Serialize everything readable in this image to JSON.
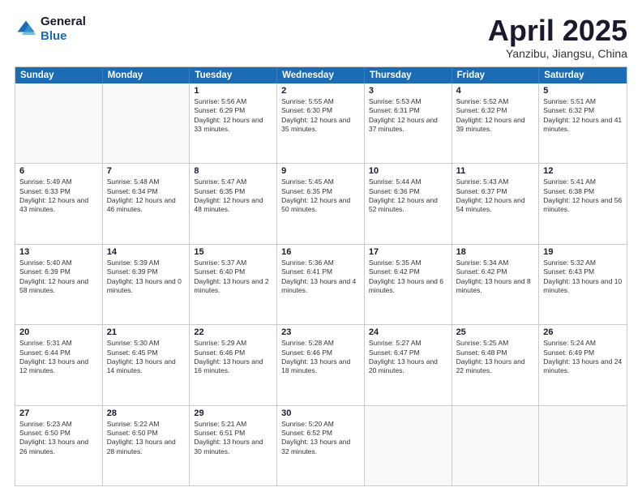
{
  "logo": {
    "line1": "General",
    "line2": "Blue"
  },
  "header": {
    "month": "April 2025",
    "location": "Yanzibu, Jiangsu, China"
  },
  "days_of_week": [
    "Sunday",
    "Monday",
    "Tuesday",
    "Wednesday",
    "Thursday",
    "Friday",
    "Saturday"
  ],
  "weeks": [
    [
      {
        "day": "",
        "empty": true
      },
      {
        "day": "",
        "empty": true
      },
      {
        "day": "1",
        "sunrise": "5:56 AM",
        "sunset": "6:29 PM",
        "daylight": "12 hours and 33 minutes."
      },
      {
        "day": "2",
        "sunrise": "5:55 AM",
        "sunset": "6:30 PM",
        "daylight": "12 hours and 35 minutes."
      },
      {
        "day": "3",
        "sunrise": "5:53 AM",
        "sunset": "6:31 PM",
        "daylight": "12 hours and 37 minutes."
      },
      {
        "day": "4",
        "sunrise": "5:52 AM",
        "sunset": "6:32 PM",
        "daylight": "12 hours and 39 minutes."
      },
      {
        "day": "5",
        "sunrise": "5:51 AM",
        "sunset": "6:32 PM",
        "daylight": "12 hours and 41 minutes."
      }
    ],
    [
      {
        "day": "6",
        "sunrise": "5:49 AM",
        "sunset": "6:33 PM",
        "daylight": "12 hours and 43 minutes."
      },
      {
        "day": "7",
        "sunrise": "5:48 AM",
        "sunset": "6:34 PM",
        "daylight": "12 hours and 46 minutes."
      },
      {
        "day": "8",
        "sunrise": "5:47 AM",
        "sunset": "6:35 PM",
        "daylight": "12 hours and 48 minutes."
      },
      {
        "day": "9",
        "sunrise": "5:45 AM",
        "sunset": "6:35 PM",
        "daylight": "12 hours and 50 minutes."
      },
      {
        "day": "10",
        "sunrise": "5:44 AM",
        "sunset": "6:36 PM",
        "daylight": "12 hours and 52 minutes."
      },
      {
        "day": "11",
        "sunrise": "5:43 AM",
        "sunset": "6:37 PM",
        "daylight": "12 hours and 54 minutes."
      },
      {
        "day": "12",
        "sunrise": "5:41 AM",
        "sunset": "6:38 PM",
        "daylight": "12 hours and 56 minutes."
      }
    ],
    [
      {
        "day": "13",
        "sunrise": "5:40 AM",
        "sunset": "6:39 PM",
        "daylight": "12 hours and 58 minutes."
      },
      {
        "day": "14",
        "sunrise": "5:39 AM",
        "sunset": "6:39 PM",
        "daylight": "13 hours and 0 minutes."
      },
      {
        "day": "15",
        "sunrise": "5:37 AM",
        "sunset": "6:40 PM",
        "daylight": "13 hours and 2 minutes."
      },
      {
        "day": "16",
        "sunrise": "5:36 AM",
        "sunset": "6:41 PM",
        "daylight": "13 hours and 4 minutes."
      },
      {
        "day": "17",
        "sunrise": "5:35 AM",
        "sunset": "6:42 PM",
        "daylight": "13 hours and 6 minutes."
      },
      {
        "day": "18",
        "sunrise": "5:34 AM",
        "sunset": "6:42 PM",
        "daylight": "13 hours and 8 minutes."
      },
      {
        "day": "19",
        "sunrise": "5:32 AM",
        "sunset": "6:43 PM",
        "daylight": "13 hours and 10 minutes."
      }
    ],
    [
      {
        "day": "20",
        "sunrise": "5:31 AM",
        "sunset": "6:44 PM",
        "daylight": "13 hours and 12 minutes."
      },
      {
        "day": "21",
        "sunrise": "5:30 AM",
        "sunset": "6:45 PM",
        "daylight": "13 hours and 14 minutes."
      },
      {
        "day": "22",
        "sunrise": "5:29 AM",
        "sunset": "6:46 PM",
        "daylight": "13 hours and 16 minutes."
      },
      {
        "day": "23",
        "sunrise": "5:28 AM",
        "sunset": "6:46 PM",
        "daylight": "13 hours and 18 minutes."
      },
      {
        "day": "24",
        "sunrise": "5:27 AM",
        "sunset": "6:47 PM",
        "daylight": "13 hours and 20 minutes."
      },
      {
        "day": "25",
        "sunrise": "5:25 AM",
        "sunset": "6:48 PM",
        "daylight": "13 hours and 22 minutes."
      },
      {
        "day": "26",
        "sunrise": "5:24 AM",
        "sunset": "6:49 PM",
        "daylight": "13 hours and 24 minutes."
      }
    ],
    [
      {
        "day": "27",
        "sunrise": "5:23 AM",
        "sunset": "6:50 PM",
        "daylight": "13 hours and 26 minutes."
      },
      {
        "day": "28",
        "sunrise": "5:22 AM",
        "sunset": "6:50 PM",
        "daylight": "13 hours and 28 minutes."
      },
      {
        "day": "29",
        "sunrise": "5:21 AM",
        "sunset": "6:51 PM",
        "daylight": "13 hours and 30 minutes."
      },
      {
        "day": "30",
        "sunrise": "5:20 AM",
        "sunset": "6:52 PM",
        "daylight": "13 hours and 32 minutes."
      },
      {
        "day": "",
        "empty": true
      },
      {
        "day": "",
        "empty": true
      },
      {
        "day": "",
        "empty": true
      }
    ]
  ],
  "labels": {
    "sunrise": "Sunrise:",
    "sunset": "Sunset:",
    "daylight": "Daylight:"
  }
}
